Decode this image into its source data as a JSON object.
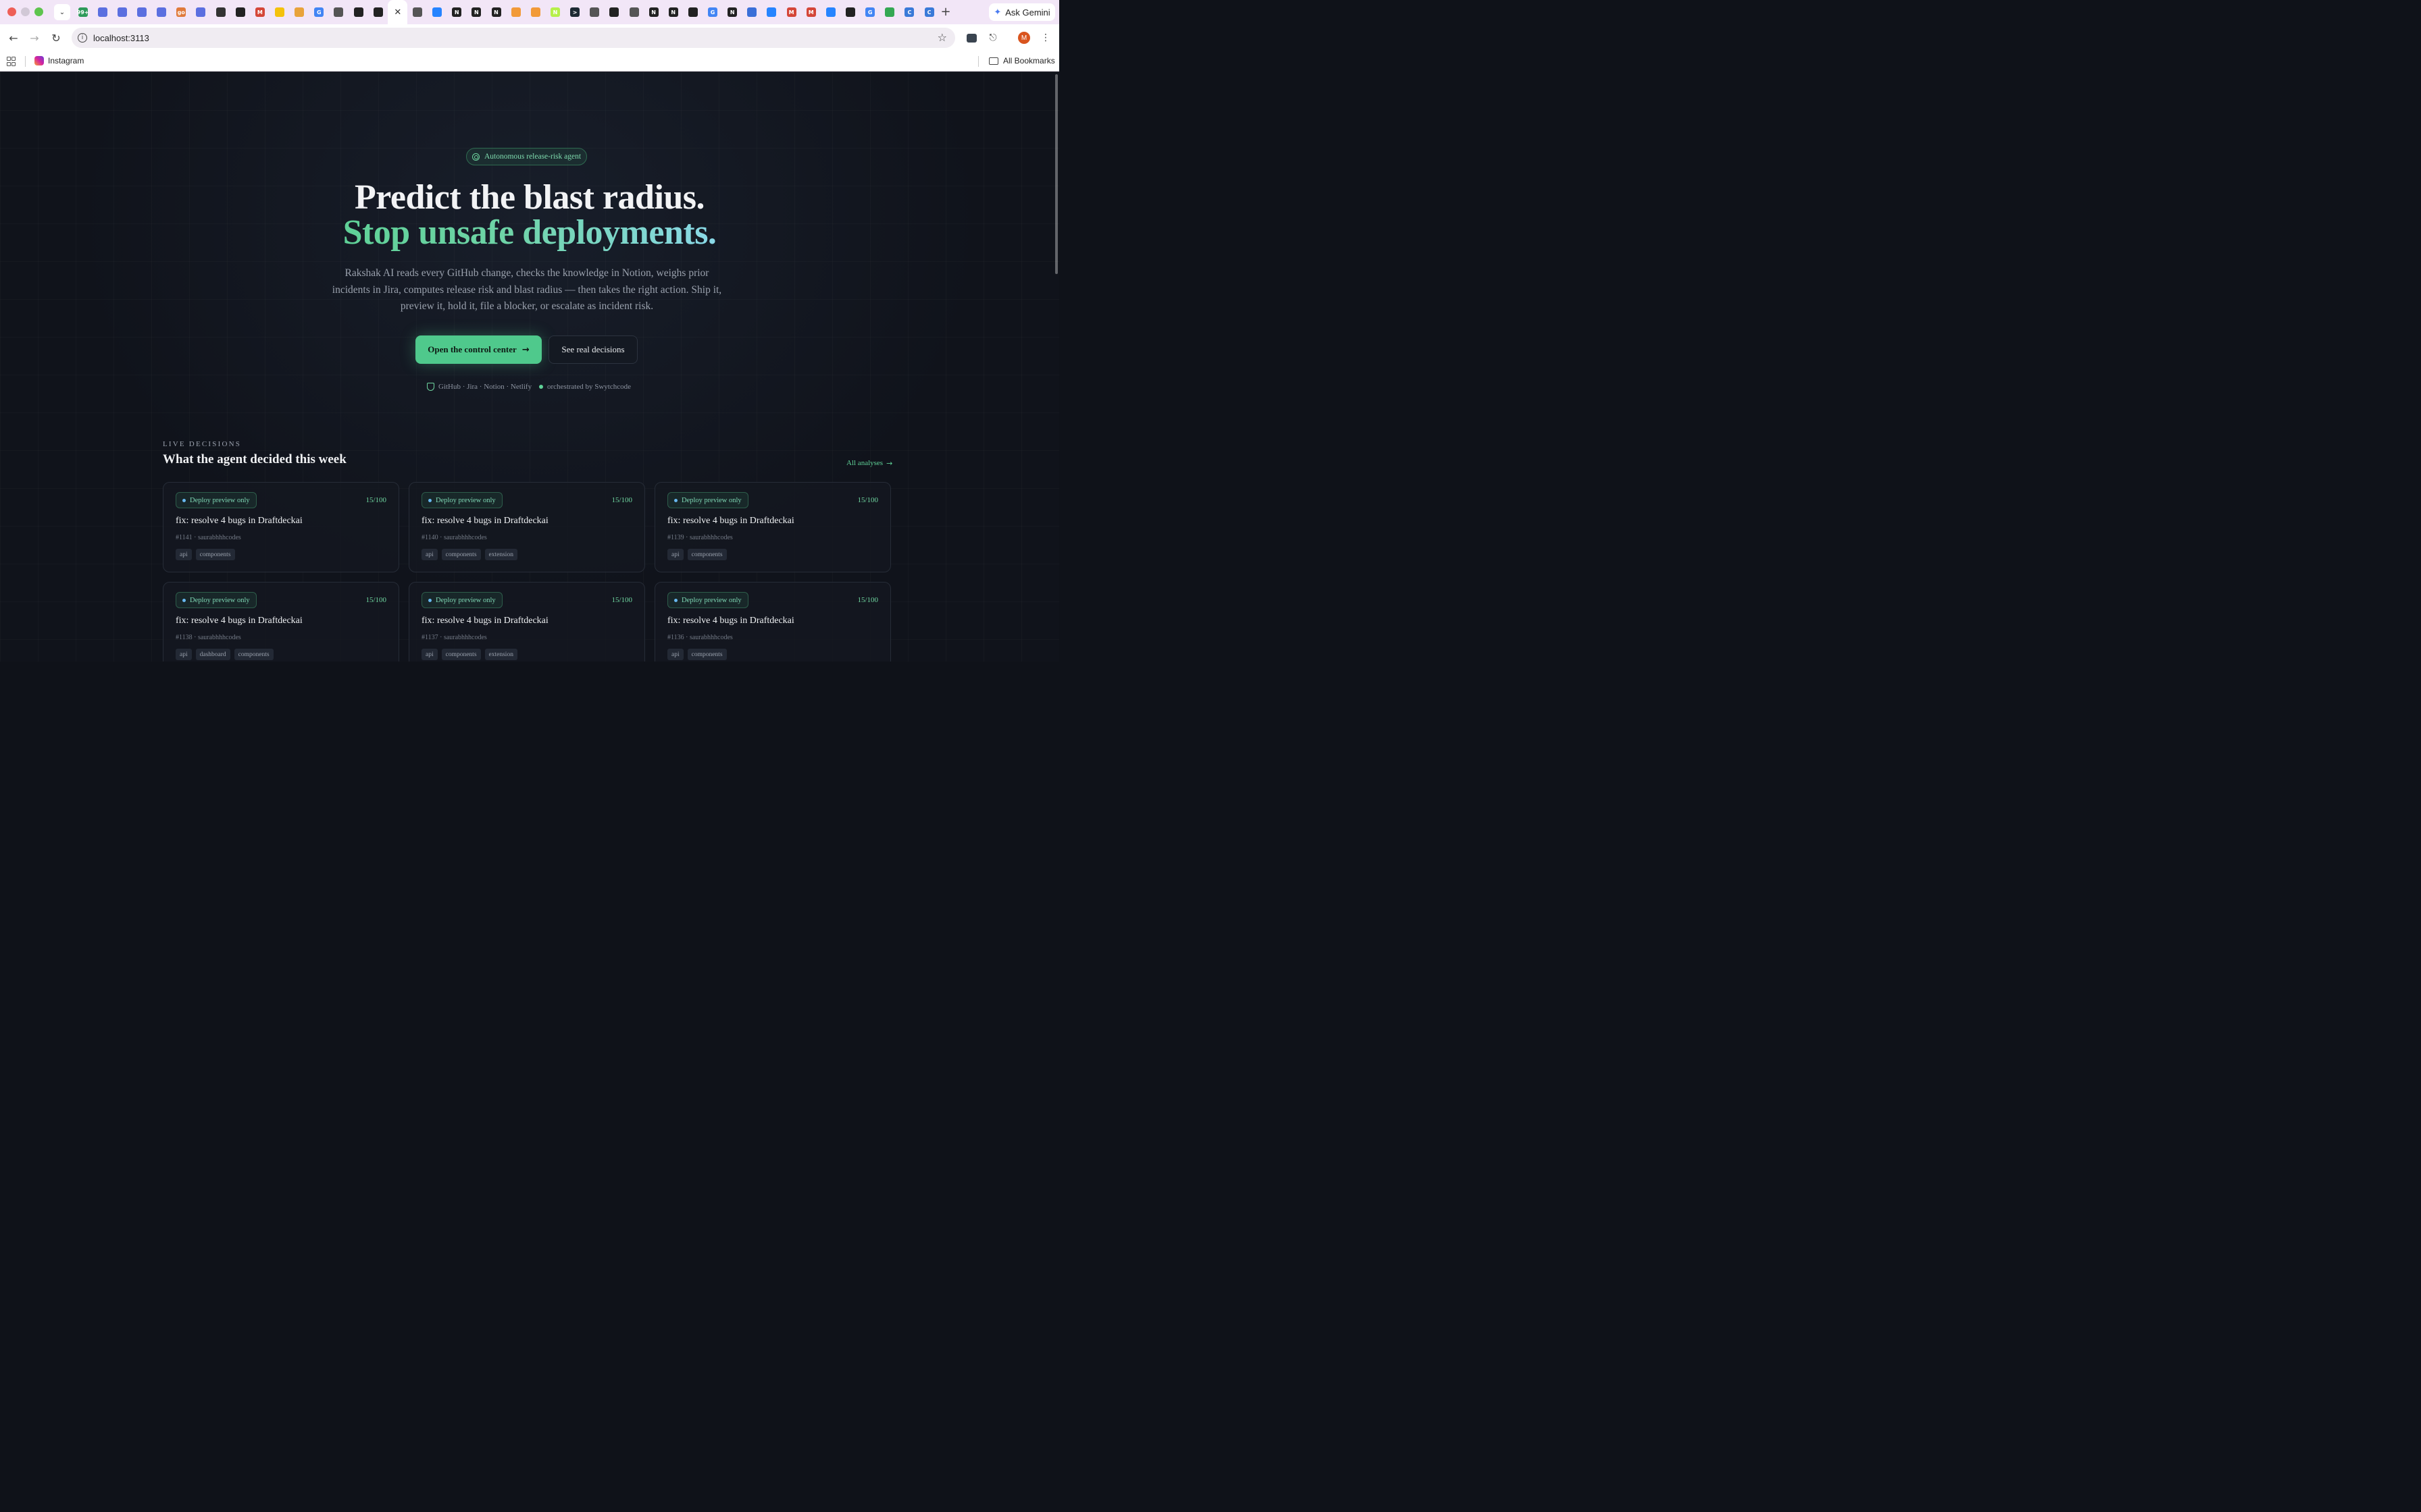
{
  "browser": {
    "url": "localhost:3113",
    "gemini_label": "Ask Gemini",
    "avatar_initial": "M",
    "bookmarks": [
      {
        "label": "Instagram"
      }
    ],
    "all_bookmarks_label": "All Bookmarks",
    "tab_badge": "99+",
    "tab_icons": [
      {
        "icon": "badge-icon",
        "color": "#2e9a5a",
        "text": "99+"
      },
      {
        "icon": "board-icon",
        "color": "#5b6fe0",
        "text": ""
      },
      {
        "icon": "board-icon",
        "color": "#5b6fe0",
        "text": ""
      },
      {
        "icon": "slides-icon",
        "color": "#5b6fe0",
        "text": ""
      },
      {
        "icon": "slides-icon",
        "color": "#5b6fe0",
        "text": ""
      },
      {
        "icon": "go-icon",
        "color": "#e07a3b",
        "text": "go"
      },
      {
        "icon": "slides-icon",
        "color": "#5b6fe0",
        "text": ""
      },
      {
        "icon": "openai-icon",
        "color": "#333333",
        "text": ""
      },
      {
        "icon": "github-icon",
        "color": "#222222",
        "text": ""
      },
      {
        "icon": "gmail-icon",
        "color": "#d44638",
        "text": "M"
      },
      {
        "icon": "keep-icon",
        "color": "#f4c20d",
        "text": ""
      },
      {
        "icon": "bars-icon",
        "color": "#e8a33b",
        "text": ""
      },
      {
        "icon": "google-icon",
        "color": "#4285f4",
        "text": "G"
      },
      {
        "icon": "globe-icon",
        "color": "#555555",
        "text": ""
      },
      {
        "icon": "github-icon",
        "color": "#222222",
        "text": ""
      },
      {
        "icon": "github-icon",
        "color": "#222222",
        "text": ""
      },
      {
        "icon": "close-icon",
        "color": "#333333",
        "text": "✕",
        "active": true
      },
      {
        "icon": "globe-icon",
        "color": "#555555",
        "text": ""
      },
      {
        "icon": "atlassian-icon",
        "color": "#2684ff",
        "text": ""
      },
      {
        "icon": "notion-icon",
        "color": "#222222",
        "text": "N"
      },
      {
        "icon": "notion-icon",
        "color": "#222222",
        "text": "N"
      },
      {
        "icon": "notion-icon",
        "color": "#222222",
        "text": "N"
      },
      {
        "icon": "swirl-icon",
        "color": "#f29a38",
        "text": ""
      },
      {
        "icon": "swirl-icon",
        "color": "#f29a38",
        "text": ""
      },
      {
        "icon": "n-icon",
        "color": "#b6f04a",
        "text": "N"
      },
      {
        "icon": "terminal-icon",
        "color": "#1d2a33",
        "text": ">"
      },
      {
        "icon": "globe-icon",
        "color": "#555555",
        "text": ""
      },
      {
        "icon": "github-icon",
        "color": "#222222",
        "text": ""
      },
      {
        "icon": "globe-icon",
        "color": "#555555",
        "text": ""
      },
      {
        "icon": "notion-icon",
        "color": "#222222",
        "text": "N"
      },
      {
        "icon": "notion-icon",
        "color": "#222222",
        "text": "N"
      },
      {
        "icon": "github-icon",
        "color": "#222222",
        "text": ""
      },
      {
        "icon": "google-icon",
        "color": "#4285f4",
        "text": "G"
      },
      {
        "icon": "notion-icon",
        "color": "#222222",
        "text": "N"
      },
      {
        "icon": "puzzle-icon",
        "color": "#3a6fd8",
        "text": ""
      },
      {
        "icon": "atlassian-icon",
        "color": "#2684ff",
        "text": ""
      },
      {
        "icon": "gmail-icon",
        "color": "#d44638",
        "text": "M"
      },
      {
        "icon": "gmail-icon",
        "color": "#d44638",
        "text": "M"
      },
      {
        "icon": "atlassian-icon",
        "color": "#2684ff",
        "text": ""
      },
      {
        "icon": "github-icon",
        "color": "#222222",
        "text": ""
      },
      {
        "icon": "google-icon",
        "color": "#4285f4",
        "text": "G"
      },
      {
        "icon": "drive-icon",
        "color": "#34a853",
        "text": ""
      },
      {
        "icon": "c-icon",
        "color": "#3a7ad8",
        "text": "C"
      },
      {
        "icon": "c-icon",
        "color": "#3a7ad8",
        "text": "C"
      }
    ]
  },
  "hero": {
    "badge": "Autonomous release-risk agent",
    "headline_line1": "Predict the blast radius.",
    "headline_line2": "Stop unsafe deployments.",
    "description": "Rakshak AI reads every GitHub change, checks the knowledge in Notion, weighs prior incidents in Jira, computes release risk and blast radius — then takes the right action. Ship it, preview it, hold it, file a blocker, or escalate as incident risk.",
    "primary_cta": "Open the control center",
    "secondary_cta": "See real decisions",
    "integrations": "GitHub · Jira · Notion · Netlify",
    "orchestrated": "orchestrated by Swytchcode"
  },
  "decisions": {
    "eyebrow": "LIVE DECISIONS",
    "title": "What the agent decided this week",
    "all_link": "All analyses",
    "cards": [
      {
        "status": "Deploy preview only",
        "score": "15/100",
        "title": "fix: resolve 4 bugs in Draftdeckai",
        "meta": "#1141 · saurabhhhcodes",
        "tags": [
          "api",
          "components"
        ]
      },
      {
        "status": "Deploy preview only",
        "score": "15/100",
        "title": "fix: resolve 4 bugs in Draftdeckai",
        "meta": "#1140 · saurabhhhcodes",
        "tags": [
          "api",
          "components",
          "extension"
        ]
      },
      {
        "status": "Deploy preview only",
        "score": "15/100",
        "title": "fix: resolve 4 bugs in Draftdeckai",
        "meta": "#1139 · saurabhhhcodes",
        "tags": [
          "api",
          "components"
        ]
      },
      {
        "status": "Deploy preview only",
        "score": "15/100",
        "title": "fix: resolve 4 bugs in Draftdeckai",
        "meta": "#1138 · saurabhhhcodes",
        "tags": [
          "api",
          "dashboard",
          "components"
        ]
      },
      {
        "status": "Deploy preview only",
        "score": "15/100",
        "title": "fix: resolve 4 bugs in Draftdeckai",
        "meta": "#1137 · saurabhhhcodes",
        "tags": [
          "api",
          "components",
          "extension"
        ]
      },
      {
        "status": "Deploy preview only",
        "score": "15/100",
        "title": "fix: resolve 4 bugs in Draftdeckai",
        "meta": "#1136 · saurabhhhcodes",
        "tags": [
          "api",
          "components"
        ]
      }
    ]
  },
  "colors": {
    "accent": "#4fc98c",
    "background": "#10131b",
    "status_dot": "#68b7f0"
  }
}
